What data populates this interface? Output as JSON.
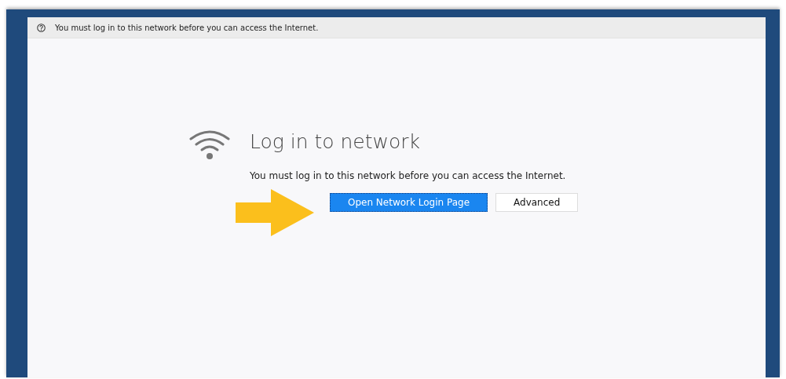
{
  "notification_bar": {
    "text": "You must log in to this network before you can access the Internet."
  },
  "page": {
    "title": "Log in to network",
    "message": "You must log in to this network before you can access the Internet.",
    "buttons": [
      {
        "label": "Open Network Login Page",
        "kind": "primary"
      },
      {
        "label": "Advanced",
        "kind": "secondary"
      }
    ]
  }
}
